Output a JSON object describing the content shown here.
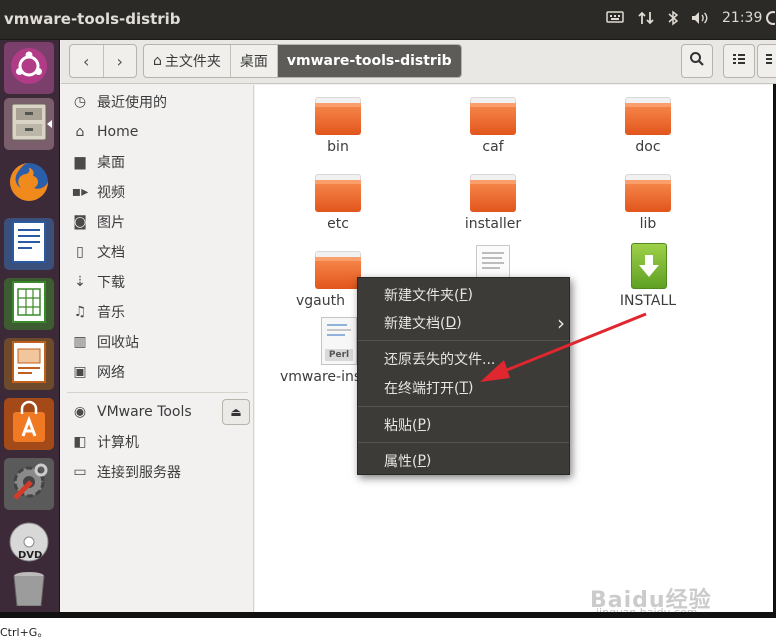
{
  "window": {
    "title": "vmware-tools-distrib"
  },
  "indicators": {
    "keyboard_icon": "keyboard-icon",
    "network_icon": "network-arrows-icon",
    "bluetooth_icon": "bluetooth-icon",
    "sound_icon": "speaker-icon",
    "time": "21:39",
    "gear_icon": "gear-icon"
  },
  "launcher": {
    "items": [
      "ubuntu-dash",
      "files",
      "firefox",
      "libreoffice-writer",
      "libreoffice-calc",
      "libreoffice-impress",
      "software-center",
      "system-settings",
      "dvd",
      "trash"
    ]
  },
  "toolbar": {
    "back": "‹",
    "forward": "›",
    "breadcrumbs": [
      "主文件夹",
      "桌面",
      "vmware-tools-distrib"
    ],
    "search_icon": "search-icon",
    "view_icon": "list-view-icon",
    "more_icon": "menu-icon"
  },
  "sidebar": {
    "items": [
      {
        "label": "最近使用的",
        "icon": "clock-icon"
      },
      {
        "label": "Home",
        "icon": "home-icon"
      },
      {
        "label": "桌面",
        "icon": "desktop-folder-icon"
      },
      {
        "label": "视频",
        "icon": "video-icon"
      },
      {
        "label": "图片",
        "icon": "camera-icon"
      },
      {
        "label": "文档",
        "icon": "document-icon"
      },
      {
        "label": "下载",
        "icon": "download-icon"
      },
      {
        "label": "音乐",
        "icon": "music-icon"
      },
      {
        "label": "回收站",
        "icon": "trash-icon"
      },
      {
        "label": "网络",
        "icon": "network-icon"
      }
    ],
    "devices": [
      {
        "label": "VMware Tools",
        "icon": "disc-icon",
        "eject": "⏏"
      },
      {
        "label": "计算机",
        "icon": "computer-icon"
      },
      {
        "label": "连接到服务器",
        "icon": "server-icon"
      }
    ]
  },
  "files": [
    {
      "name": "bin",
      "type": "folder"
    },
    {
      "name": "caf",
      "type": "folder"
    },
    {
      "name": "doc",
      "type": "folder"
    },
    {
      "name": "etc",
      "type": "folder"
    },
    {
      "name": "installer",
      "type": "folder"
    },
    {
      "name": "lib",
      "type": "folder"
    },
    {
      "name": "vgauth",
      "type": "folder"
    },
    {
      "name": "",
      "type": "text-file"
    },
    {
      "name": "INSTALL",
      "type": "install-file"
    },
    {
      "name": "vmware-ins",
      "type": "perl-script",
      "badge": "Perl"
    }
  ],
  "context_menu": {
    "items": [
      {
        "label": "新建文件夹(",
        "key": "F",
        "tail": ")"
      },
      {
        "label": "新建文档(",
        "key": "D",
        "tail": ")"
      },
      {
        "label": "还原丢失的文件...",
        "key": "",
        "tail": ""
      },
      {
        "label": "在终端打开(",
        "key": "T",
        "tail": ")"
      },
      {
        "label": "粘贴(",
        "key": "P",
        "tail": ")"
      },
      {
        "label": "属性(",
        "key": "P",
        "tail": ")"
      }
    ],
    "submenu_arrow": "›"
  },
  "annotation": {
    "color": "#e0262e"
  },
  "statusbar": {
    "text": "Ctrl+G。"
  },
  "watermark": {
    "text": "Baidu经验",
    "url": "jingyan.baidu.com"
  }
}
